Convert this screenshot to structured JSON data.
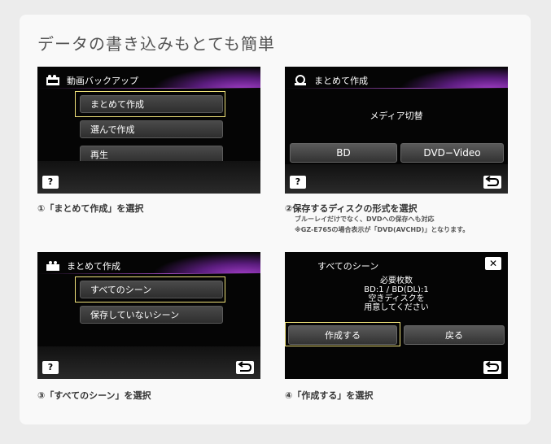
{
  "title": "データの書き込みもとても簡単",
  "screens": {
    "s1": {
      "header": "動画バックアップ",
      "items": [
        "まとめて作成",
        "選んで作成",
        "再生"
      ],
      "help": "?"
    },
    "s2": {
      "header": "まとめて作成",
      "prompt": "メディア切替",
      "buttons": [
        "BD",
        "DVD−Video"
      ],
      "help": "?"
    },
    "s3": {
      "header": "まとめて作成",
      "items": [
        "すべてのシーン",
        "保存していないシーン"
      ],
      "help": "?"
    },
    "s4": {
      "header": "すべてのシーン",
      "lines": [
        "必要枚数",
        "BD:1 / BD(DL):1",
        "空きディスクを",
        "用意してください"
      ],
      "buttons": [
        "作成する",
        "戻る"
      ],
      "close": "✕"
    }
  },
  "captions": {
    "c1": "①「まとめて作成」を選択",
    "c2": "②保存するディスクの形式を選択",
    "c2_sub1": "ブルーレイだけでなく、DVDへの保存へも対応",
    "c2_sub2": "※GZ-E765の場合表示が「DVD(AVCHD)」となります。",
    "c3": "③「すべてのシーン」を選択",
    "c4": "④「作成する」を選択"
  },
  "colors": {
    "highlight": "#f0e27a",
    "accent": "#a33fc8"
  }
}
